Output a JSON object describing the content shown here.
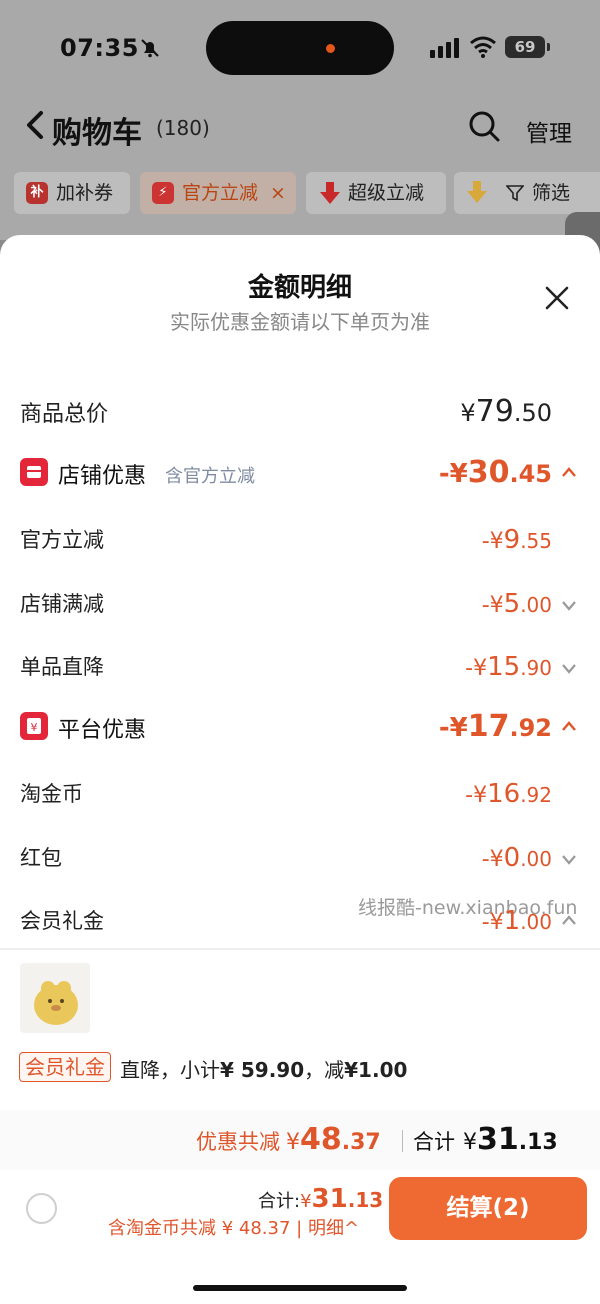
{
  "status_bar": {
    "time": "07:35",
    "battery": "69"
  },
  "nav": {
    "title": "购物车",
    "count": "(180)",
    "manage": "管理"
  },
  "chips": [
    {
      "icon_text": "补",
      "label": "加补券"
    },
    {
      "label": "官方立减",
      "close": "×"
    },
    {
      "label": "超级立减"
    },
    {
      "label": "筛选"
    }
  ],
  "sheet": {
    "title": "金额明细",
    "subtitle": "实际优惠金额请以下单页为准",
    "total": {
      "label": "商品总价",
      "yen": "¥",
      "int": "79",
      "dec": ".50"
    },
    "store": {
      "label": "店铺优惠",
      "sub": "含官方立减",
      "amount": {
        "yen": "-¥",
        "int": "30",
        "dec": ".45"
      },
      "items": [
        {
          "label": "官方立减",
          "yen": "-¥",
          "int": "9",
          "dec": ".55"
        },
        {
          "label": "店铺满减",
          "yen": "-¥",
          "int": "5",
          "dec": ".00"
        },
        {
          "label": "单品直降",
          "yen": "-¥",
          "int": "15",
          "dec": ".90"
        }
      ]
    },
    "platform": {
      "label": "平台优惠",
      "amount": {
        "yen": "-¥",
        "int": "17",
        "dec": ".92"
      },
      "items": [
        {
          "label": "淘金币",
          "yen": "-¥",
          "int": "16",
          "dec": ".92"
        },
        {
          "label": "红包",
          "yen": "-¥",
          "int": "0",
          "dec": ".00"
        },
        {
          "label": "会员礼金",
          "yen": "-¥",
          "int": "1",
          "dec": ".00"
        }
      ]
    },
    "watermark": "线报酷-new.xianbao.fun",
    "tag": "会员礼金",
    "tag_desc_prefix": "直降，小计",
    "tag_desc_subtotal": "¥ 59.90",
    "tag_desc_mid": "，减",
    "tag_desc_reduce": "¥1.00"
  },
  "summary": {
    "save_label": "优惠共减",
    "save_yen": "¥",
    "save_int": "48",
    "save_dec": ".37",
    "total_label": "合计",
    "total_yen": "¥",
    "total_int": "31",
    "total_dec": ".13"
  },
  "bottom": {
    "total_label": "合计:",
    "total_yen": "¥",
    "total_int": "31",
    "total_dec": ".13",
    "save_text": "含淘金币共减 ¥ 48.37",
    "detail": "| 明细^",
    "checkout": "结算(2)"
  },
  "colors": {
    "accent": "#e0562b",
    "button": "#ef6a33",
    "section_icon": "#e3263a"
  }
}
